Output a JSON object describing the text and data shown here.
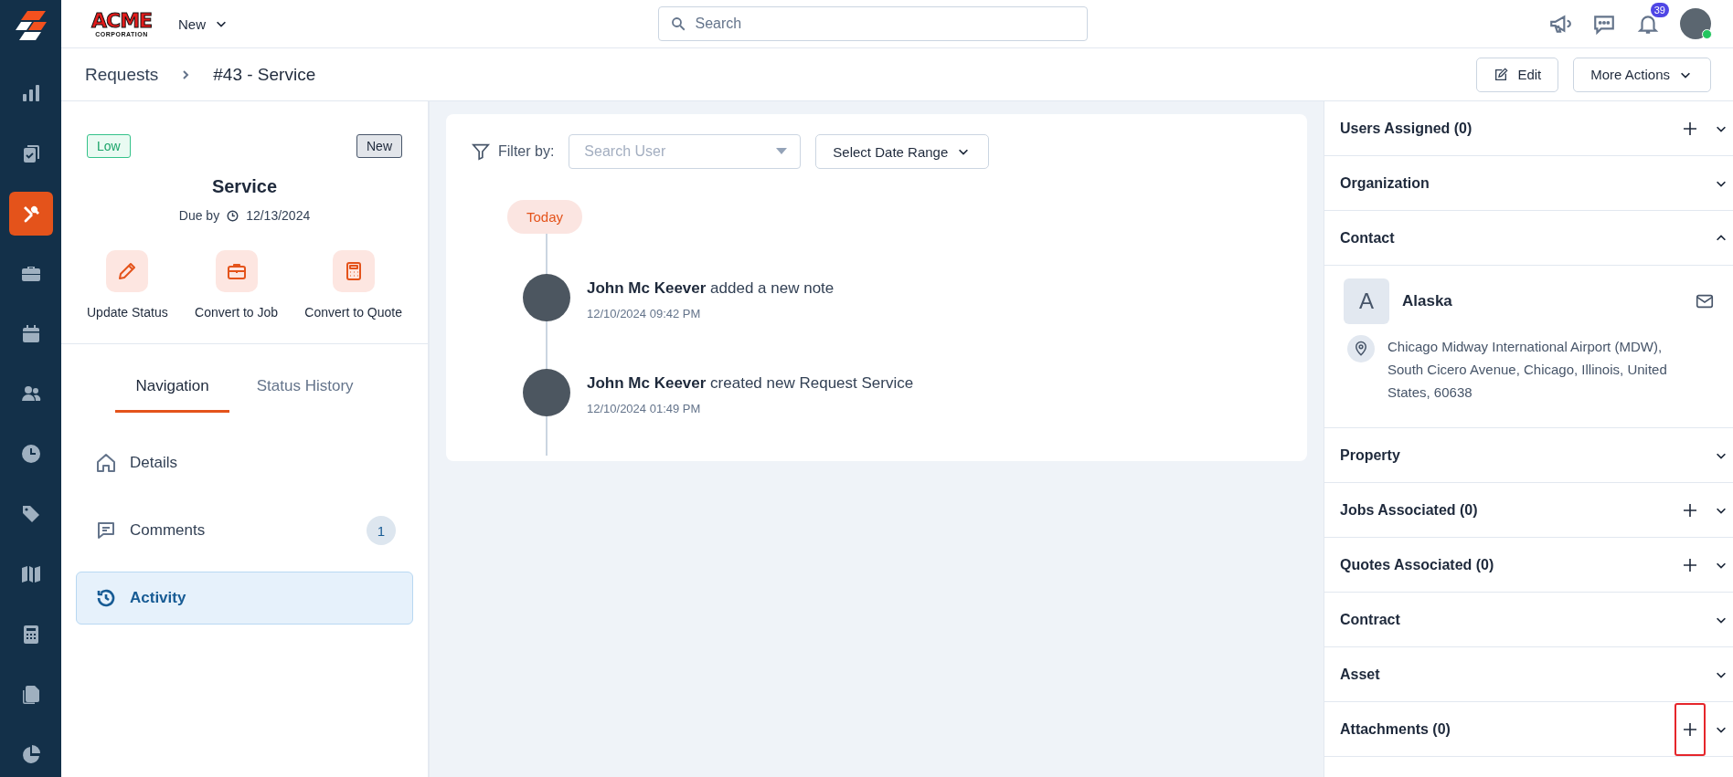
{
  "sidebar": {
    "items": [
      {
        "selected": false
      },
      {
        "selected": false
      },
      {
        "selected": true
      },
      {
        "selected": false
      },
      {
        "selected": false
      },
      {
        "selected": false
      },
      {
        "selected": false
      },
      {
        "selected": false
      },
      {
        "selected": false
      },
      {
        "selected": false
      },
      {
        "selected": false
      },
      {
        "selected": false
      }
    ]
  },
  "topbar": {
    "logo_title": "ACME",
    "logo_subtitle": "CORPORATION",
    "new_menu": "New",
    "search": {
      "placeholder": "Search"
    },
    "notification_count": "39",
    "user_online": true
  },
  "breadcrumb": [
    "Requests",
    "#43 - Service"
  ],
  "actions": {
    "edit": "Edit",
    "more": "More Actions"
  },
  "request": {
    "priority": "Low",
    "status": "New",
    "title": "Service",
    "due_label": "Due by",
    "due_date": "12/13/2024",
    "quick_actions": [
      "Update Status",
      "Convert to Job",
      "Convert to Quote"
    ],
    "tabs": [
      {
        "label": "Navigation",
        "selected": true
      },
      {
        "label": "Status History",
        "selected": false
      }
    ],
    "nav": [
      {
        "label": "Details",
        "selected": false
      },
      {
        "label": "Comments",
        "selected": false,
        "count": "1"
      },
      {
        "label": "Activity",
        "selected": true
      }
    ]
  },
  "activity": {
    "filter_label": "Filter by:",
    "user_search": {
      "placeholder": "Search User"
    },
    "date_range": "Select Date Range",
    "day": "Today",
    "entries": [
      {
        "text": "**John Mc Keever** added a new note",
        "time": "12/10/2024 09:42 PM"
      },
      {
        "text": "**John Mc Keever** created new Request Service",
        "time": "12/10/2024 01:49 PM"
      }
    ]
  },
  "panels": [
    {
      "title": "Users Assigned (0)",
      "add": true,
      "add_highlighted": false,
      "expanded": false
    },
    {
      "title": "Organization",
      "add": false,
      "expanded": false
    },
    {
      "title": "Contact",
      "add": false,
      "expanded": true,
      "contact": {
        "initial": "A",
        "name": "Alaska",
        "address": "Chicago Midway International Airport (MDW), South Cicero Avenue, Chicago, Illinois, United States, 60638"
      }
    },
    {
      "title": "Property",
      "add": false,
      "expanded": false
    },
    {
      "title": "Jobs Associated (0)",
      "add": true,
      "add_highlighted": false,
      "expanded": false
    },
    {
      "title": "Quotes Associated (0)",
      "add": true,
      "add_highlighted": false,
      "expanded": false
    },
    {
      "title": "Contract",
      "add": false,
      "expanded": false
    },
    {
      "title": "Asset",
      "add": false,
      "expanded": false
    },
    {
      "title": "Attachments (0)",
      "add": true,
      "add_highlighted": true,
      "expanded": false
    }
  ]
}
